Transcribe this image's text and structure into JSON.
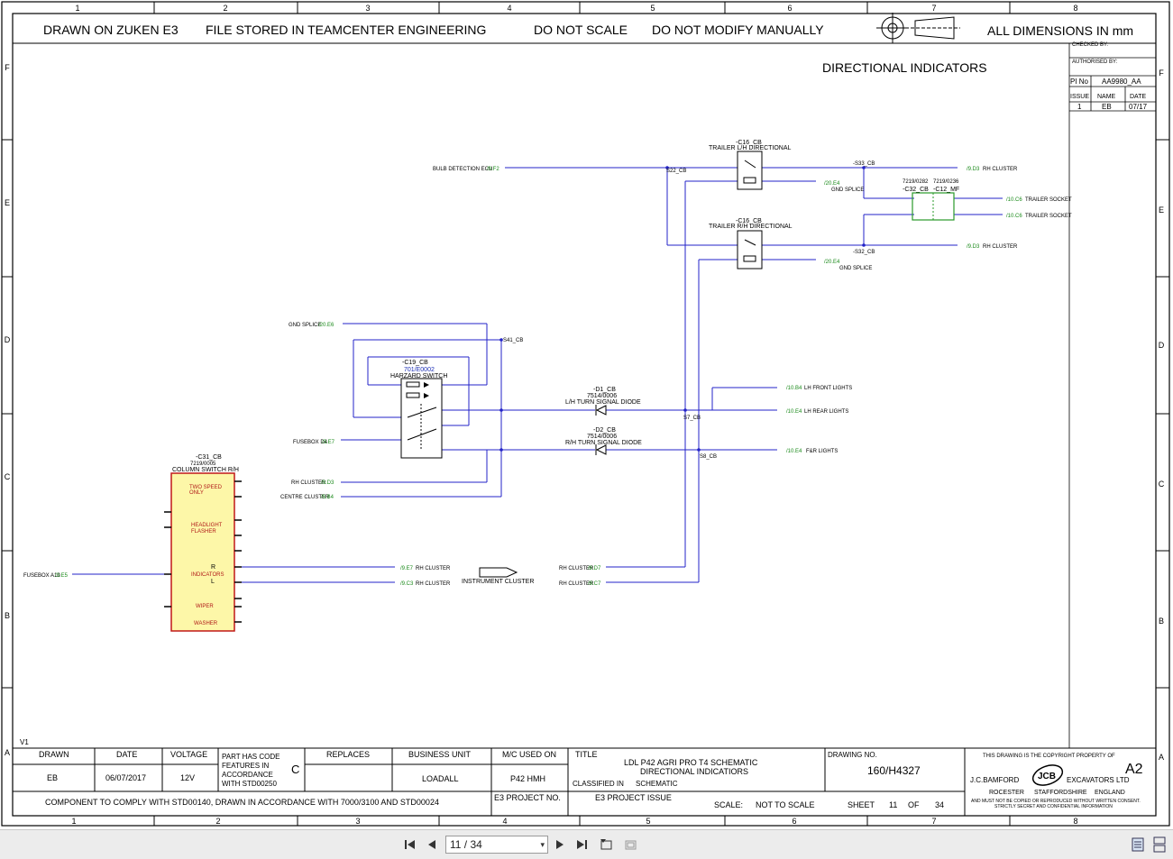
{
  "header": {
    "drawn_on": "DRAWN ON ZUKEN E3",
    "file_stored": "FILE STORED IN TEAMCENTER ENGINEERING",
    "do_not_scale": "DO NOT SCALE",
    "do_not_modify": "DO NOT MODIFY MANUALLY",
    "all_dimensions": "ALL DIMENSIONS IN mm"
  },
  "grid": {
    "columns": [
      "1",
      "2",
      "3",
      "4",
      "5",
      "6",
      "7",
      "8"
    ],
    "rows": [
      "F",
      "E",
      "D",
      "C",
      "B",
      "A"
    ]
  },
  "title": "DIRECTIONAL INDICATORS",
  "revision_box": {
    "checked_by": "CHECKED BY:",
    "authorised_by": "AUTHORISED BY:",
    "pi_no_label": "PI No",
    "pi_no_value": "AA9980_AA",
    "issue_label": "ISSUE",
    "name_label": "NAME",
    "date_label": "DATE",
    "issue_value": "1",
    "name_value": "EB",
    "date_value": "07/17"
  },
  "components": {
    "c16_lh_ref": "-C16_CB",
    "c16_lh_name": "TRAILER L/H DIRECTIONAL",
    "c16_rh_ref": "-C16_CB",
    "c16_rh_name": "TRAILER R/H DIRECTIONAL",
    "c19_ref": "-C19_CB",
    "c19_part": "701/E0002",
    "c19_name": "HARZARD SWITCH",
    "d1_ref": "-D1_CB",
    "d1_part": "7514/0006",
    "d1_name": "L/H TURN SIGNAL DIODE",
    "d2_ref": "-D2_CB",
    "d2_part": "7514/0006",
    "d2_name": "R/H TURN SIGNAL DIODE",
    "c31_ref": "-C31_CB",
    "c31_part": "7219/0005",
    "c31_name": "COLUMN SWITCH R/H",
    "c32_part": "7219/0282",
    "c32_ref": "-C32_CB",
    "c12_part": "7219/0236",
    "c12_ref": "-C12_MF",
    "instrument_cluster": "INSTRUMENT CLUSTER"
  },
  "column_switch": {
    "two_speed": "TWO SPEED",
    "only": "ONLY",
    "headlight": "HEADLIGHT",
    "flasher": "FLASHER",
    "r": "R",
    "indicators": "INDICATORS",
    "l": "L",
    "wiper": "WIPER",
    "washer": "WASHER"
  },
  "connections": {
    "bulb_ecu": "BULB DETECTION ECU",
    "bulb_ecu_ref": "/9.F2",
    "rh_cluster_1": "RH CLUSTER",
    "rh_cluster_1_ref": "/9.D3",
    "gnd_splice_1": "GND SPLICE",
    "gnd_splice_1_ref": "/20.E4",
    "trailer_socket_1": "TRAILER SOCKET",
    "trailer_socket_1_ref": "/10.C6",
    "trailer_socket_2": "TRAILER SOCKET",
    "trailer_socket_2_ref": "/10.C6",
    "rh_cluster_2": "RH CLUSTER",
    "rh_cluster_2_ref": "/9.D3",
    "gnd_splice_2": "GND SPLICE",
    "gnd_splice_2_ref": "/20.E4",
    "gnd_splice_left": "GND SPLICE",
    "gnd_splice_left_ref": "/20.E6",
    "fusebox_d4": "FUSEBOX D4",
    "fusebox_d4_ref": "/3.E7",
    "rh_cluster_left": "RH CLUSTER",
    "rh_cluster_left_ref": "/9.D3",
    "centre_cluster": "CENTRE CLUSTER",
    "centre_cluster_ref": "/9.B4",
    "lh_front": "LH FRONT LIGHTS",
    "lh_front_ref": "/10.B4",
    "lh_rear": "LH REAR LIGHTS",
    "lh_rear_ref": "/10.E4",
    "fr_lights": "F&R LIGHTS",
    "fr_lights_ref": "/10.E4",
    "fusebox_a10": "FUSEBOX A10",
    "fusebox_a10_ref": "/3.E5",
    "rh_cluster_e7": "RH CLUSTER",
    "rh_cluster_e7_ref": "/9.E7",
    "rh_cluster_c3": "RH CLUSTER",
    "rh_cluster_c3_ref": "/9.C3",
    "rh_cluster_d7": "RH CLUSTER",
    "rh_cluster_d7_ref": "/9.D7",
    "rh_cluster_c7": "RH CLUSTER",
    "rh_cluster_c7_ref": "/9.C7"
  },
  "splices": {
    "s22": "S22_CB",
    "s33": "-S33_CB",
    "s32": "-S32_CB",
    "s41": "S41_CB",
    "s7": "S7_CB",
    "s8": "S8_CB"
  },
  "version": "V1",
  "title_block": {
    "drawn_label": "DRAWN",
    "drawn_value": "EB",
    "date_label": "DATE",
    "date_value": "06/07/2017",
    "voltage_label": "VOLTAGE",
    "voltage_value": "12V",
    "part_code_1": "PART HAS CODE",
    "part_code_2": "FEATURES IN",
    "part_code_3": "ACCORDANCE",
    "part_code_4": "WITH STD00250",
    "part_code_letter": "C",
    "replaces_label": "REPLACES",
    "business_unit_label": "BUSINESS UNIT",
    "business_unit_value": "LOADALL",
    "mc_used_label": "M/C USED ON",
    "mc_used_value": "P42 HMH",
    "title_label": "TITLE",
    "title_line1": "LDL P42 AGRI PRO T4 SCHEMATIC",
    "title_line2": "DIRECTIONAL INDICATIORS",
    "classified_label": "CLASSIFIED IN",
    "classified_value": "SCHEMATIC",
    "drawing_no_label": "DRAWING NO.",
    "drawing_no_value": "160/H4327",
    "copyright": "THIS DRAWING IS THE COPYRIGHT PROPERTY OF",
    "size": "A2",
    "company_left": "J.C.BAMFORD",
    "company_right": "EXCAVATORS LTD",
    "logo": "JCB",
    "loc1": "ROCESTER",
    "loc2": "STAFFORDSHIRE",
    "loc3": "ENGLAND",
    "notice1": "AND MUST NOT BE COPIED OR REPRODUCED WITHOUT WRITTEN CONSENT.",
    "notice2": "STRICTLY SECRET AND CONFIDENTIAL INFORMATION",
    "comply": "COMPONENT TO COMPLY WITH STD00140, DRAWN IN ACCORDANCE WITH 7000/3100 AND STD00024",
    "e3_project_no_label": "E3 PROJECT NO.",
    "e3_project_issue_label": "E3 PROJECT ISSUE",
    "scale_label": "SCALE:",
    "scale_value": "NOT TO SCALE",
    "sheet_label": "SHEET",
    "sheet_value": "11",
    "of_label": "OF",
    "of_value": "34"
  },
  "viewer": {
    "page_indicator": "11 / 34"
  }
}
